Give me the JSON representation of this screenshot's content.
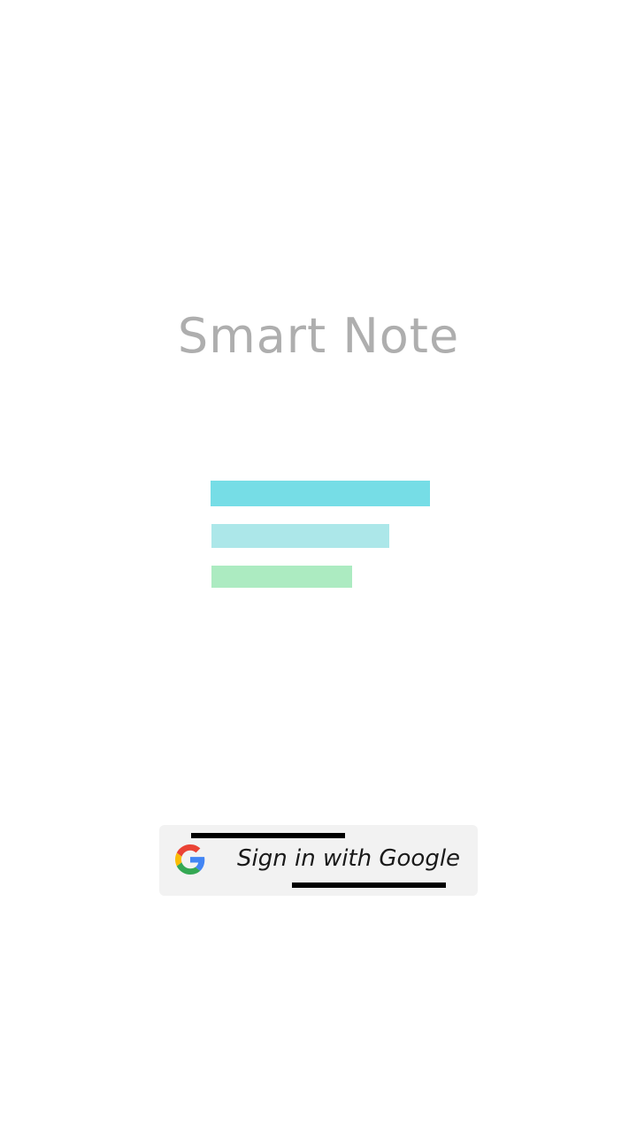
{
  "app": {
    "title": "Smart Note"
  },
  "logo": {
    "icon": "notes-logo-icon",
    "bar_colors": [
      "#76dde6",
      "#ace7e9",
      "#acebc1"
    ]
  },
  "signin": {
    "label": "Sign in with Google",
    "icon": "google-icon",
    "background": "#f2f2f2"
  }
}
